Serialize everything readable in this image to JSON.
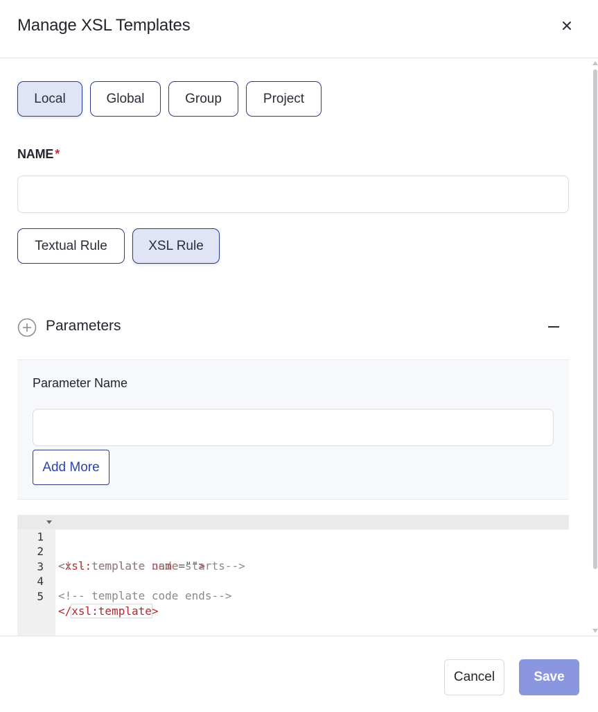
{
  "modal": {
    "title": "Manage XSL Templates",
    "close_icon": "close-icon"
  },
  "scope_tabs": [
    {
      "label": "Local",
      "active": true
    },
    {
      "label": "Global",
      "active": false
    },
    {
      "label": "Group",
      "active": false
    },
    {
      "label": "Project",
      "active": false
    }
  ],
  "name_field": {
    "label": "NAME",
    "required_mark": "*",
    "value": "",
    "placeholder": ""
  },
  "rule_tabs": [
    {
      "label": "Textual Rule",
      "active": false
    },
    {
      "label": "XSL Rule",
      "active": true
    }
  ],
  "parameters": {
    "title": "Parameters",
    "add_icon": "plus-circle-icon",
    "collapse_icon": "minus-icon",
    "param_name_label": "Parameter Name",
    "param_name_value": "",
    "add_more_label": "Add More"
  },
  "editor": {
    "lines": [
      {
        "number": "1",
        "text": "<xsl:template name=\"\">"
      },
      {
        "number": "2",
        "text": "<!-- template code starts-->"
      },
      {
        "number": "3",
        "text": ""
      },
      {
        "number": "4",
        "text": "<!-- template code ends-->"
      },
      {
        "number": "5",
        "text": "</xsl:template>"
      }
    ]
  },
  "footer": {
    "cancel_label": "Cancel",
    "save_label": "Save"
  },
  "colors": {
    "accent_border": "#2c3a8c",
    "active_tab_bg": "#e1e4f5",
    "save_button_bg": "#8a96e0",
    "required": "#d42a2a",
    "xml_tag": "#b9242a",
    "xml_comment": "#8a8a8a"
  }
}
